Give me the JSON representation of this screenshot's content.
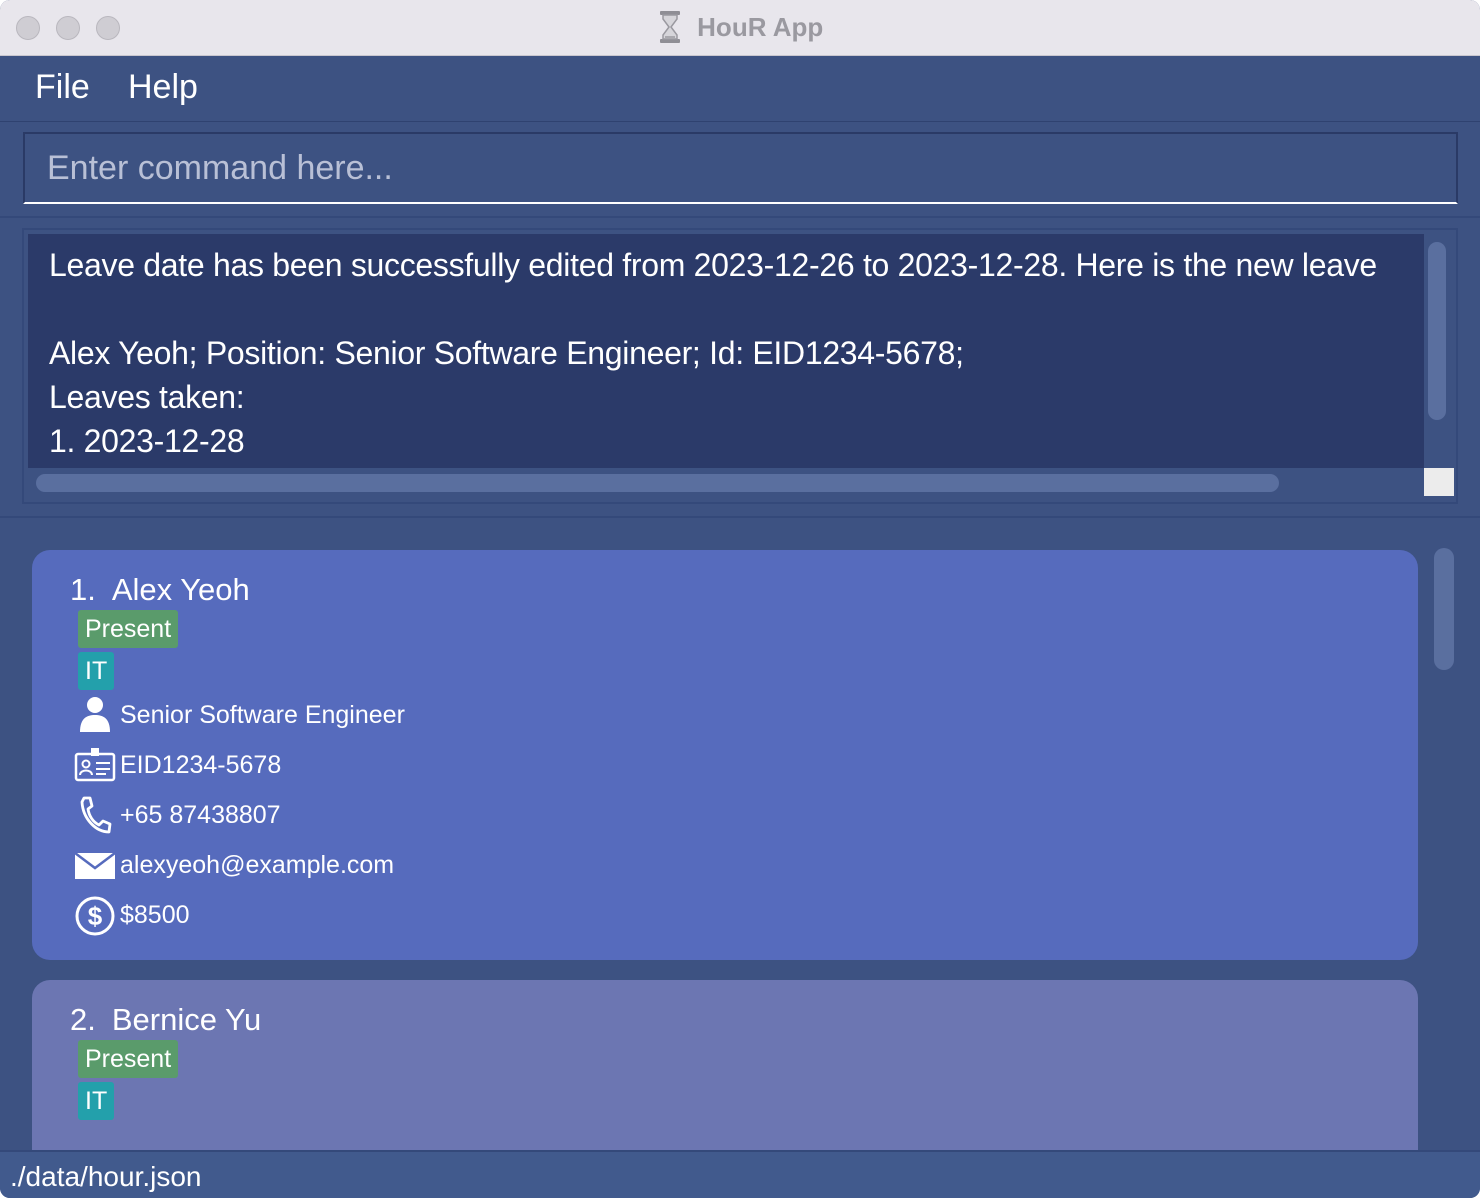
{
  "window": {
    "title": "HouR App",
    "title_icon": "hourglass-icon"
  },
  "menu": {
    "file": "File",
    "help": "Help"
  },
  "command": {
    "placeholder": "Enter command here...",
    "value": ""
  },
  "result": {
    "lines": [
      "Leave date has been successfully edited from 2023-12-26 to 2023-12-28. Here is the new leave",
      "",
      "Alex Yeoh; Position: Senior Software Engineer; Id: EID1234-5678;",
      "Leaves taken:",
      "1. 2023-12-28"
    ]
  },
  "persons": [
    {
      "index": "1.",
      "name": "Alex Yeoh",
      "status": "Present",
      "department": "IT",
      "position": "Senior Software Engineer",
      "id": "EID1234-5678",
      "phone": "+65 87438807",
      "email": "alexyeoh@example.com",
      "salary": "$8500",
      "selected": true
    },
    {
      "index": "2.",
      "name": "Bernice Yu",
      "status": "Present",
      "department": "IT"
    }
  ],
  "status_bar": {
    "path": "./data/hour.json"
  },
  "colors": {
    "background": "#3d5282",
    "result_bg": "#2b3a69",
    "card_selected": "#566bbd",
    "card": "#6c76b2",
    "tag_status": "#5a9b6b",
    "tag_department": "#23a0ab"
  }
}
